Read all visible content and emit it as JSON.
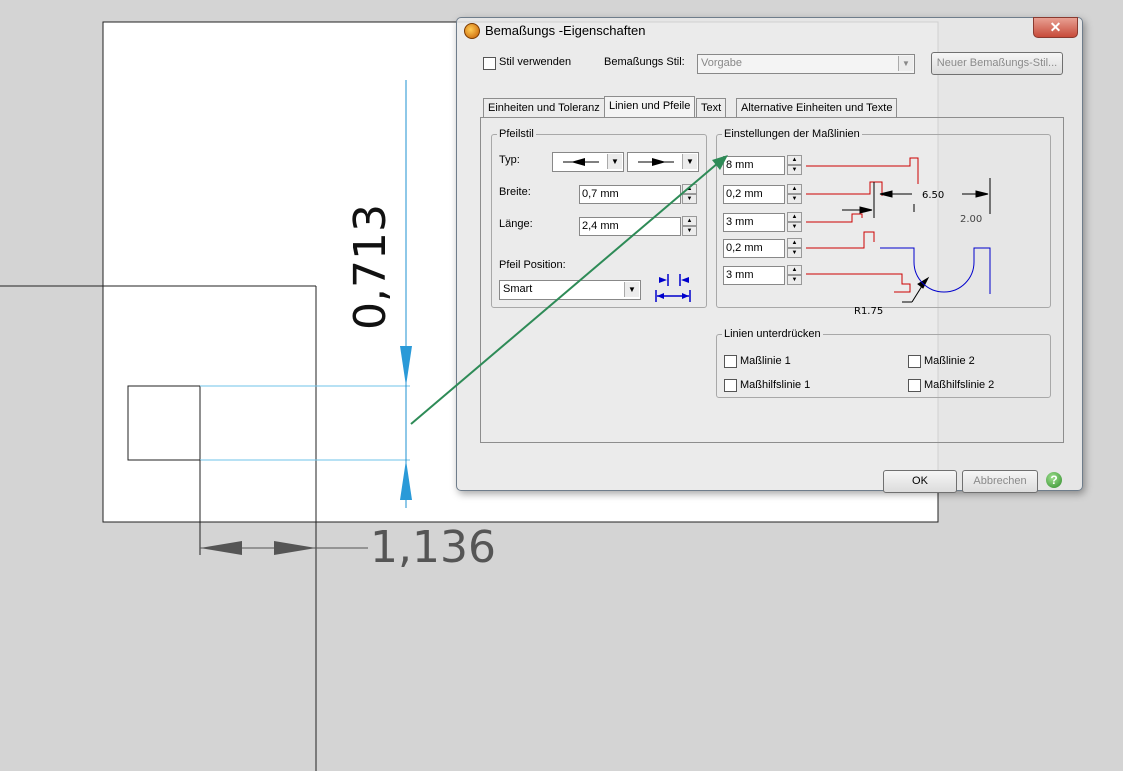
{
  "cad": {
    "vertical_dimension": "0,713",
    "horizontal_dimension": "1,136"
  },
  "dialog": {
    "title": "Bemaßungs -Eigenschaften",
    "close_symbol": "✕",
    "use_style_label": "Stil verwenden",
    "style_label": "Bemaßungs Stil:",
    "style_value": "Vorgabe",
    "new_style_button": "Neuer Bemaßungs-Stil...",
    "tabs": [
      {
        "label": "Einheiten und Toleranz"
      },
      {
        "label": "Linien und Pfeile"
      },
      {
        "label": "Text"
      },
      {
        "label": "Alternative Einheiten und Texte"
      }
    ],
    "arrow_style": {
      "group_title": "Pfeilstil",
      "type_label": "Typ:",
      "width_label": "Breite:",
      "width_value": "0,7 mm",
      "length_label": "Länge:",
      "length_value": "2,4 mm",
      "position_label": "Pfeil Position:",
      "position_value": "Smart"
    },
    "dimension_lines": {
      "group_title": "Einstellungen der Maßlinien",
      "values": [
        "8 mm",
        "0,2 mm",
        "3 mm",
        "0,2 mm",
        "3 mm"
      ],
      "preview_labels": [
        "6.50",
        "2.00",
        "R1.75"
      ]
    },
    "suppress": {
      "group_title": "Linien unterdrücken",
      "items": [
        "Maßlinie 1",
        "Maßlinie 2",
        "Maßhilfslinie 1",
        "Maßhilfslinie 2"
      ]
    },
    "ok_button": "OK",
    "cancel_button": "Abbrechen",
    "help_symbol": "?"
  },
  "colors": {
    "annotation_arrow": "#2e8b57",
    "dimension_blue": "#1e90d0",
    "preview_red": "#cc0000",
    "preview_blue": "#0000cc"
  }
}
